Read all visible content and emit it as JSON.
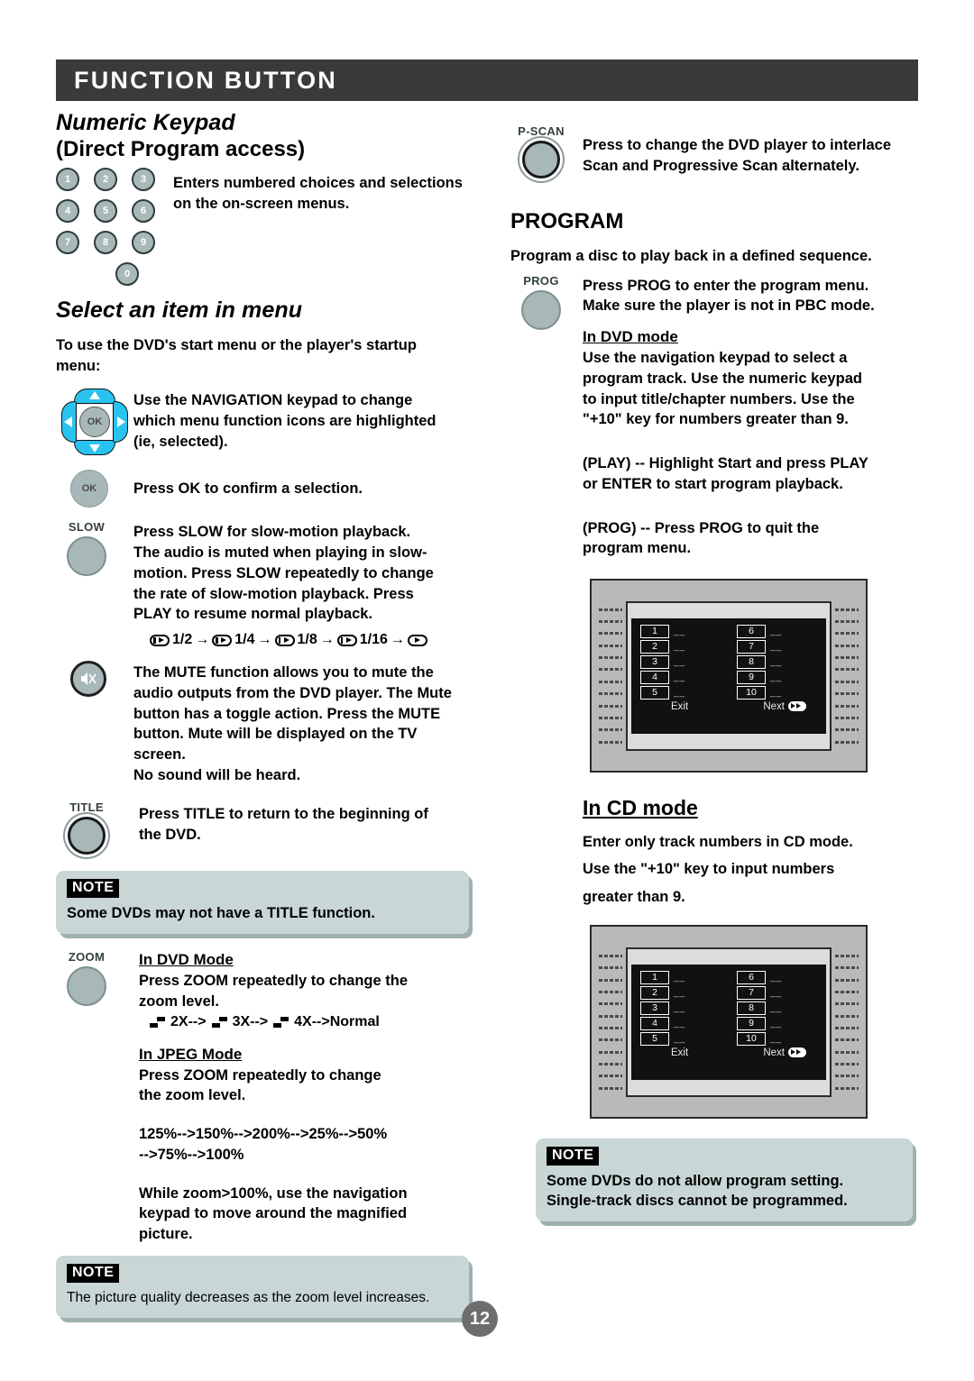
{
  "page": {
    "header_title": "FUNCTION  BUTTON",
    "page_number": "12"
  },
  "left": {
    "numeric_keypad": {
      "heading_italic": "Numeric Keypad",
      "heading_sub": "(Direct Program access)",
      "keys": [
        "1",
        "2",
        "3",
        "4",
        "5",
        "6",
        "7",
        "8",
        "9",
        "0"
      ],
      "description_line1": "Enters numbered choices and selections",
      "description_line2": "on the on-screen menus."
    },
    "select_item": {
      "heading_italic": "Select an item in menu",
      "intro_line1": "To use the DVD's start menu or the player's startup",
      "intro_line2": "menu:"
    },
    "navigation": {
      "ok_label": "OK",
      "text_line1": "Use the NAVIGATION keypad to change",
      "text_line2": "which menu function icons are highlighted",
      "text_line3": "(ie, selected)."
    },
    "ok_button": {
      "label": "OK",
      "text": "Press OK to confirm a selection."
    },
    "slow": {
      "button_label": "SLOW",
      "text_line1": "Press SLOW for slow-motion playback.",
      "text_line2": "The audio is muted when playing in slow-",
      "text_line3": "motion. Press SLOW repeatedly to change",
      "text_line4": "the rate of slow-motion playback. Press",
      "text_line5": "PLAY to resume normal playback.",
      "sequence": [
        "1/2",
        "1/4",
        "1/8",
        "1/16"
      ],
      "arrow": "→"
    },
    "mute": {
      "text_line1": "The MUTE function allows you to mute the",
      "text_line2": "audio outputs from the DVD player. The Mute",
      "text_line3": "button has a toggle action. Press the MUTE",
      "text_line4": "button. Mute will be displayed on the TV",
      "text_line5": "screen.",
      "text_line6": "No sound will be heard."
    },
    "title": {
      "button_label": "TITLE",
      "text_line1": "Press TITLE to return to the beginning of",
      "text_line2": "the DVD."
    },
    "note_title": {
      "badge": "NOTE",
      "text": "Some DVDs may not have a TITLE function."
    },
    "zoom": {
      "button_label": "ZOOM",
      "dvd_heading": "In DVD Mode",
      "dvd_line1": "Press ZOOM repeatedly to change the",
      "dvd_line2": "zoom level.",
      "dvd_sequence": [
        "2X-->",
        "3X-->",
        "4X-->Normal"
      ],
      "jpeg_heading": "In JPEG Mode",
      "jpeg_line1": "Press ZOOM repeatedly to change",
      "jpeg_line2": "the zoom level.",
      "jpeg_seq_line1": "125%-->150%-->200%-->25%-->50%",
      "jpeg_seq_line2": "-->75%-->100%",
      "nav_line1": "While zoom>100%, use the navigation",
      "nav_line2": "keypad to move around the magnified",
      "nav_line3": "picture."
    },
    "note_zoom": {
      "badge": "NOTE",
      "text": "The picture quality decreases as the zoom level increases."
    }
  },
  "right": {
    "pscan": {
      "button_label": "P-SCAN",
      "text_line1": "Press to change the DVD player to interlace",
      "text_line2": "Scan and Progressive Scan alternately."
    },
    "program": {
      "heading": "PROGRAM",
      "intro": "Program a disc to play back in a defined sequence.",
      "prog_button_label": "PROG",
      "prog_line1": "Press PROG to enter the program menu.",
      "prog_line2": "Make sure the player is not in PBC mode.",
      "dvd_heading": "In DVD mode",
      "dvd_line1": "Use the navigation keypad to select a",
      "dvd_line2": "program track. Use the numeric keypad",
      "dvd_line3": "to input title/chapter numbers. Use the",
      "dvd_line4": "\"+10\" key for numbers greater than 9.",
      "play_line1": "(PLAY) -- Highlight Start and press PLAY",
      "play_line2": "or ENTER to start program playback.",
      "prog_quit_line1": "(PROG) -- Press PROG to quit the",
      "prog_quit_line2": "program menu."
    },
    "tv_menu": {
      "left_column": [
        "1",
        "2",
        "3",
        "4",
        "5"
      ],
      "right_column": [
        "6",
        "7",
        "8",
        "9",
        "10"
      ],
      "blank_value": "__",
      "exit_label": "Exit",
      "next_label": "Next"
    },
    "cd_mode": {
      "heading": "In CD mode",
      "line1": "Enter only track numbers in CD mode.",
      "line2": "Use the \"+10\" key to input numbers",
      "line3": "greater than 9."
    },
    "note_program": {
      "badge": "NOTE",
      "text_line1": "Some DVDs do not allow program setting.",
      "text_line2": "Single-track discs cannot be programmed."
    }
  }
}
